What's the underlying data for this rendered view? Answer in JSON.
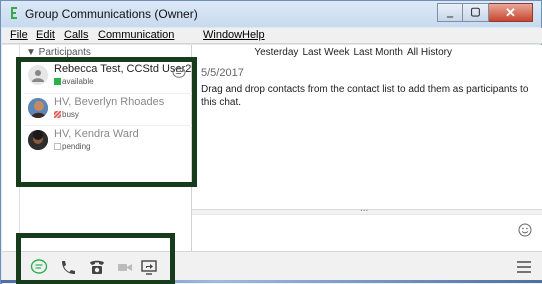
{
  "window": {
    "title": "Group Communications (Owner)",
    "buttons": {
      "minimize": "minimize",
      "maximize": "maximize",
      "close": "close"
    }
  },
  "menu": {
    "items": [
      {
        "label": "File"
      },
      {
        "label": "Edit"
      },
      {
        "label": "Calls"
      },
      {
        "label": "Communication"
      },
      {
        "label": "Window"
      },
      {
        "label": "Help"
      }
    ]
  },
  "participants": {
    "header": "▼ Participants",
    "list": [
      {
        "name": "Rebecca Test, CCStd User2",
        "status": "available",
        "status_color": "#2bb24c"
      },
      {
        "name": "HV, Beverlyn Rhoades",
        "status": "busy",
        "status_color": "#d9534f"
      },
      {
        "name": "HV, Kendra Ward",
        "status": "pending",
        "status_color": "#bdbdbd"
      }
    ]
  },
  "history": {
    "links": [
      "Yesterday",
      "Last Week",
      "Last Month",
      "All History"
    ]
  },
  "conversation": {
    "date": "5/5/2017",
    "info": "Drag and drop contacts from the contact list to add them as participants to this chat."
  },
  "splitter": {
    "dots": "..."
  },
  "toolbar": {
    "chat_icon": "chat-icon",
    "phone_icon": "phone-icon",
    "desk_phone_icon": "desk-phone-icon",
    "video_icon": "video-icon",
    "screen_share_icon": "screen-share-icon",
    "menu_icon": "menu-icon"
  },
  "colors": {
    "highlight": "#163c1c",
    "accent_green": "#2bb24c"
  }
}
